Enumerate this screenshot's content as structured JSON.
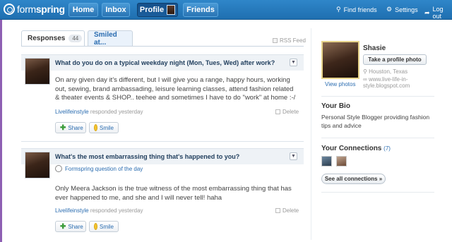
{
  "brand": {
    "logo_text_light": "form",
    "logo_text_bold": "spring"
  },
  "nav": {
    "home": "Home",
    "inbox": "Inbox",
    "profile": "Profile",
    "friends": "Friends",
    "find_friends": "Find friends",
    "settings": "Settings",
    "logout": "Log out"
  },
  "tabs": {
    "responses_label": "Responses",
    "responses_count": "44",
    "smiled_label": "Smiled at..."
  },
  "rss_label": "RSS Feed",
  "questions": [
    {
      "title": "What do you do on a typical weekday night (Mon, Tues, Wed) after work?",
      "subtitle": "",
      "body": "On any given day it's different, but I will give you a range, happy hours, working out, sewing, brand ambassading, leisure learning classes, attend fashion related & theater events & SHOP.. teehee and sometimes I have to do \"work\" at home :-/",
      "user": "Livelifeinstyle",
      "meta": "responded yesterday",
      "delete": "Delete",
      "share": "Share",
      "smile": "Smile"
    },
    {
      "title": "What's the most embarrassing thing that's happened to you?",
      "subtitle": "Formspring question of the day",
      "body": "Only Meera Jackson is the true witness of the most embarrassing thing that has ever happened to me, and she and I will never tell! haha",
      "user": "Livelifeinstyle",
      "meta": "responded yesterday",
      "delete": "Delete",
      "share": "Share",
      "smile": "Smile"
    }
  ],
  "profile": {
    "name": "Shasie",
    "take_photo": "Take a profile photo",
    "view_photos": "View photos",
    "location": "Houston, Texas",
    "website": "www.live-life-in-style.blogspot.com"
  },
  "bio": {
    "title": "Your Bio",
    "text": "Personal Style Blogger providing fashion tips and advice"
  },
  "connections": {
    "title": "Your Connections",
    "count": "(7)",
    "see_all": "See all connections »"
  },
  "colors": {
    "topbar": "#2478bd",
    "link": "#2a6cb0",
    "accent_stripe": "#8e5fb3"
  }
}
